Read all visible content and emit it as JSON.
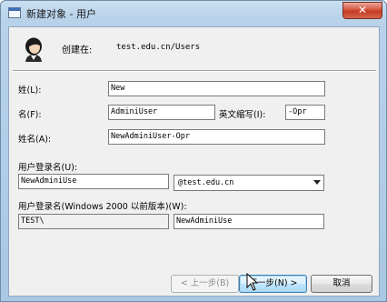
{
  "window": {
    "title": "新建对象 - 用户",
    "close_glyph": "✕"
  },
  "header": {
    "created_in_label": "创建在:",
    "created_in_path": "test.edu.cn/Users"
  },
  "form": {
    "last_name_label": "姓(L):",
    "last_name_value": "New",
    "first_name_label": "名(F):",
    "first_name_value": "AdminiUser",
    "initials_label": "英文缩写(I):",
    "initials_value": "-Opr",
    "full_name_label": "姓名(A):",
    "full_name_value": "NewAdminiUser-Opr",
    "logon_name_label": "用户登录名(U):",
    "logon_name_value": "NewAdminiUse",
    "domain_suffix_value": "@test.edu.cn",
    "pre2000_label": "用户登录名(Windows 2000 以前版本)(W):",
    "pre2000_domain_value": "TEST\\",
    "pre2000_name_value": "NewAdminiUse"
  },
  "buttons": {
    "back_label": "< 上一步(B)",
    "next_label": "下一步(N) >",
    "cancel_label": "取消"
  },
  "icons": {
    "user": "user-avatar-icon",
    "dropdown": "chevron-down-icon",
    "cursor": "mouse-pointer-icon"
  }
}
